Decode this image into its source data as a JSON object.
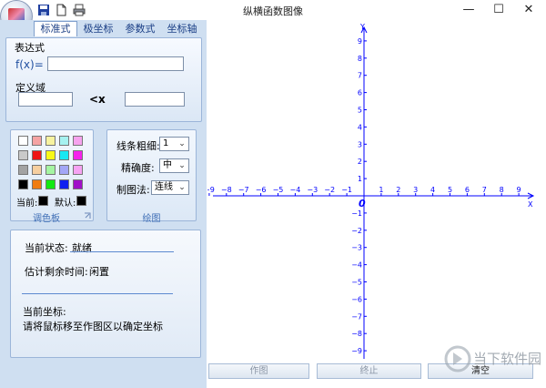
{
  "window": {
    "title": "纵横函数图像",
    "minimize": "—",
    "maximize": "☐",
    "close": "✕"
  },
  "tabs": [
    {
      "label": "标准式",
      "active": true
    },
    {
      "label": "极坐标"
    },
    {
      "label": "参数式"
    },
    {
      "label": "坐标轴"
    }
  ],
  "expression": {
    "group_label": "表达式",
    "fx_label": "f(x)=",
    "value": "",
    "domain_label": "定义域",
    "domain_min": "",
    "lt_x": "<x",
    "domain_max": ""
  },
  "palette": {
    "title": "调色板",
    "colors": [
      "#ffffff",
      "#f5a3a3",
      "#f7f3a0",
      "#a6f2f0",
      "#f6a3ee",
      "#c9c9c9",
      "#ee1515",
      "#f8f818",
      "#17e8f3",
      "#f522ec",
      "#a3a3a3",
      "#f6cfa0",
      "#a5f5a2",
      "#a3a6f6",
      "#f6a3f3",
      "#000000",
      "#f07c12",
      "#12e812",
      "#1020f0",
      "#a010c8"
    ],
    "current_label": "当前:",
    "current_color": "#000000",
    "default_label": "默认:",
    "default_color": "#000000"
  },
  "drawing": {
    "title": "绘图",
    "line_width_label": "线条粗细:",
    "line_width_value": "1",
    "precision_label": "精确度:",
    "precision_value": "中",
    "method_label": "制图法:",
    "method_value": "连线"
  },
  "status": {
    "state_label": "当前状态:",
    "state_value": "就绪",
    "remaining_label": "估计剩余时间:",
    "remaining_value": "闲置",
    "coord_label": "当前坐标:",
    "coord_hint": "请将鼠标移至作图区以确定坐标"
  },
  "buttons": {
    "draw": "作图",
    "stop": "终止",
    "clear": "清空"
  },
  "chart_data": {
    "type": "line",
    "xlabel": "X",
    "ylabel": "Y",
    "origin_label": "0",
    "x_ticks": [
      -9,
      -8,
      -7,
      -6,
      -5,
      -4,
      -3,
      -2,
      -1,
      1,
      2,
      3,
      4,
      5,
      6,
      7,
      8,
      9
    ],
    "y_ticks": [
      9,
      8,
      7,
      6,
      5,
      4,
      3,
      2,
      1,
      -1,
      -2,
      -3,
      -4,
      -5,
      -6,
      -7,
      -8,
      -9
    ],
    "xlim": [
      -9.5,
      9.5
    ],
    "ylim": [
      -9.5,
      9.5
    ],
    "axis_color": "#0000ff",
    "series": []
  },
  "watermark": {
    "text": "当下软件园"
  }
}
